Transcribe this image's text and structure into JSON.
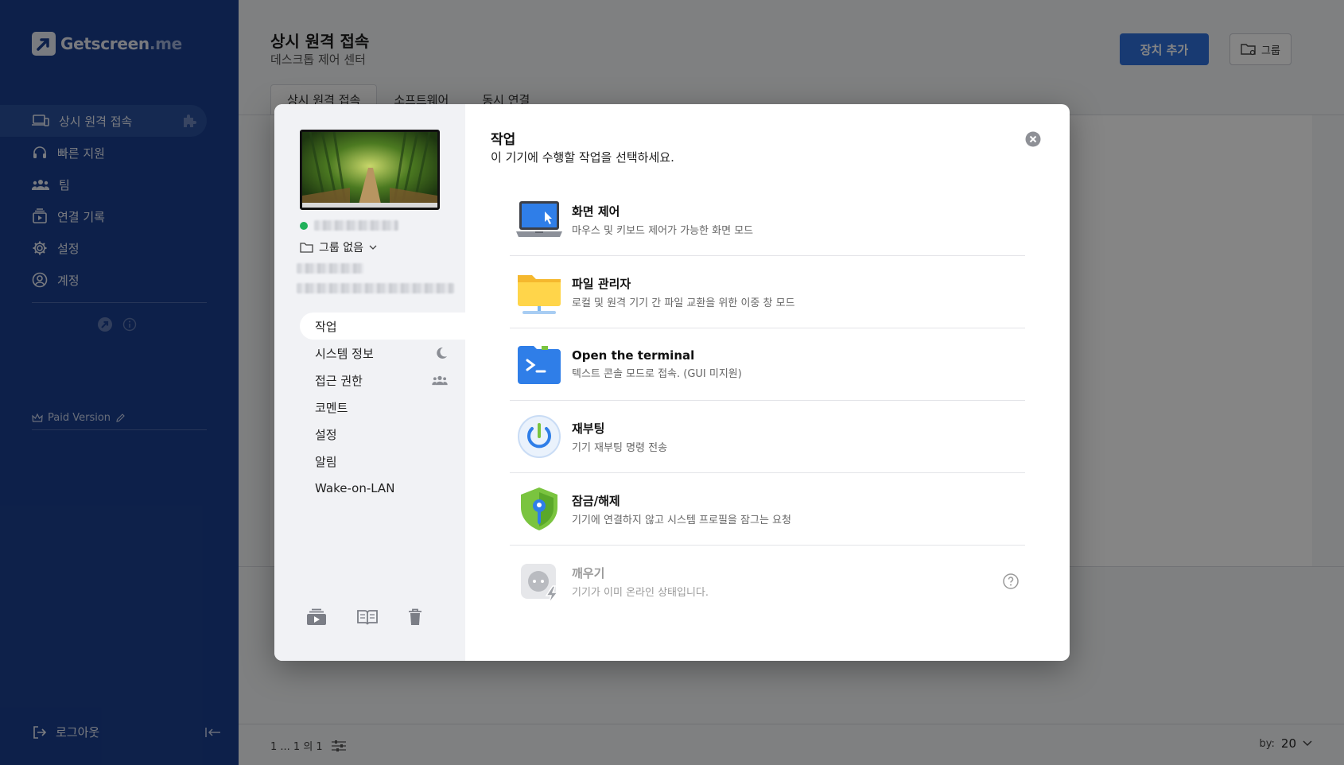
{
  "app": {
    "logo_main": "Getscreen",
    "logo_tld": ".me"
  },
  "sidebar": {
    "items": [
      {
        "label": "상시 원격 접속",
        "icon": "devices-icon"
      },
      {
        "label": "빠른 지원",
        "icon": "headset-icon"
      },
      {
        "label": "팀",
        "icon": "team-icon"
      },
      {
        "label": "연결 기록",
        "icon": "history-icon"
      },
      {
        "label": "설정",
        "icon": "gear-icon"
      },
      {
        "label": "계정",
        "icon": "account-icon"
      }
    ],
    "paid": "Paid Version",
    "logout": "로그아웃"
  },
  "header": {
    "title": "상시 원격 접속",
    "subtitle": "데스크톱 제어 센터",
    "add_button": "장치 추가",
    "group_button": "그룹"
  },
  "tabs": [
    "상시 원격 접속",
    "소프트웨어",
    "동시 연결"
  ],
  "footer": {
    "pager": "1 ... 1 의 1",
    "per_page_label": "by:",
    "per_page_value": "20"
  },
  "modal": {
    "group": "그룹 없음",
    "nav": [
      {
        "label": "작업"
      },
      {
        "label": "시스템 정보",
        "icon": "moon-icon"
      },
      {
        "label": "접근 권한",
        "icon": "team-icon"
      },
      {
        "label": "코멘트"
      },
      {
        "label": "설정"
      },
      {
        "label": "알림"
      },
      {
        "label": "Wake-on-LAN"
      }
    ],
    "title": "작업",
    "subtitle": "이 기기에 수행할 작업을 선택하세요.",
    "actions": [
      {
        "title": "화면 제어",
        "desc": "마우스 및 키보드 제어가 가능한 화면 모드",
        "icon": "laptop-icon"
      },
      {
        "title": "파일 관리자",
        "desc": "로컬 및 원격 기기 간 파일 교환을 위한 이중 창 모드",
        "icon": "folder-icon"
      },
      {
        "title": "Open the terminal",
        "desc": "텍스트 콘솔 모드로 접속. (GUI 미지원)",
        "icon": "terminal-icon"
      },
      {
        "title": "재부팅",
        "desc": "기기 재부팅 명령 전송",
        "icon": "power-icon"
      },
      {
        "title": "잠금/해제",
        "desc": "기기에 연결하지 않고 시스템 프로필을 잠그는 요청",
        "icon": "shield-key-icon"
      },
      {
        "title": "깨우기",
        "desc": "기기가 이미 온라인 상태입니다.",
        "icon": "plug-icon",
        "disabled": true
      }
    ]
  },
  "colors": {
    "sidebar": "#1a3f8e",
    "accent": "#2f6fdb",
    "online": "#20b15a"
  }
}
